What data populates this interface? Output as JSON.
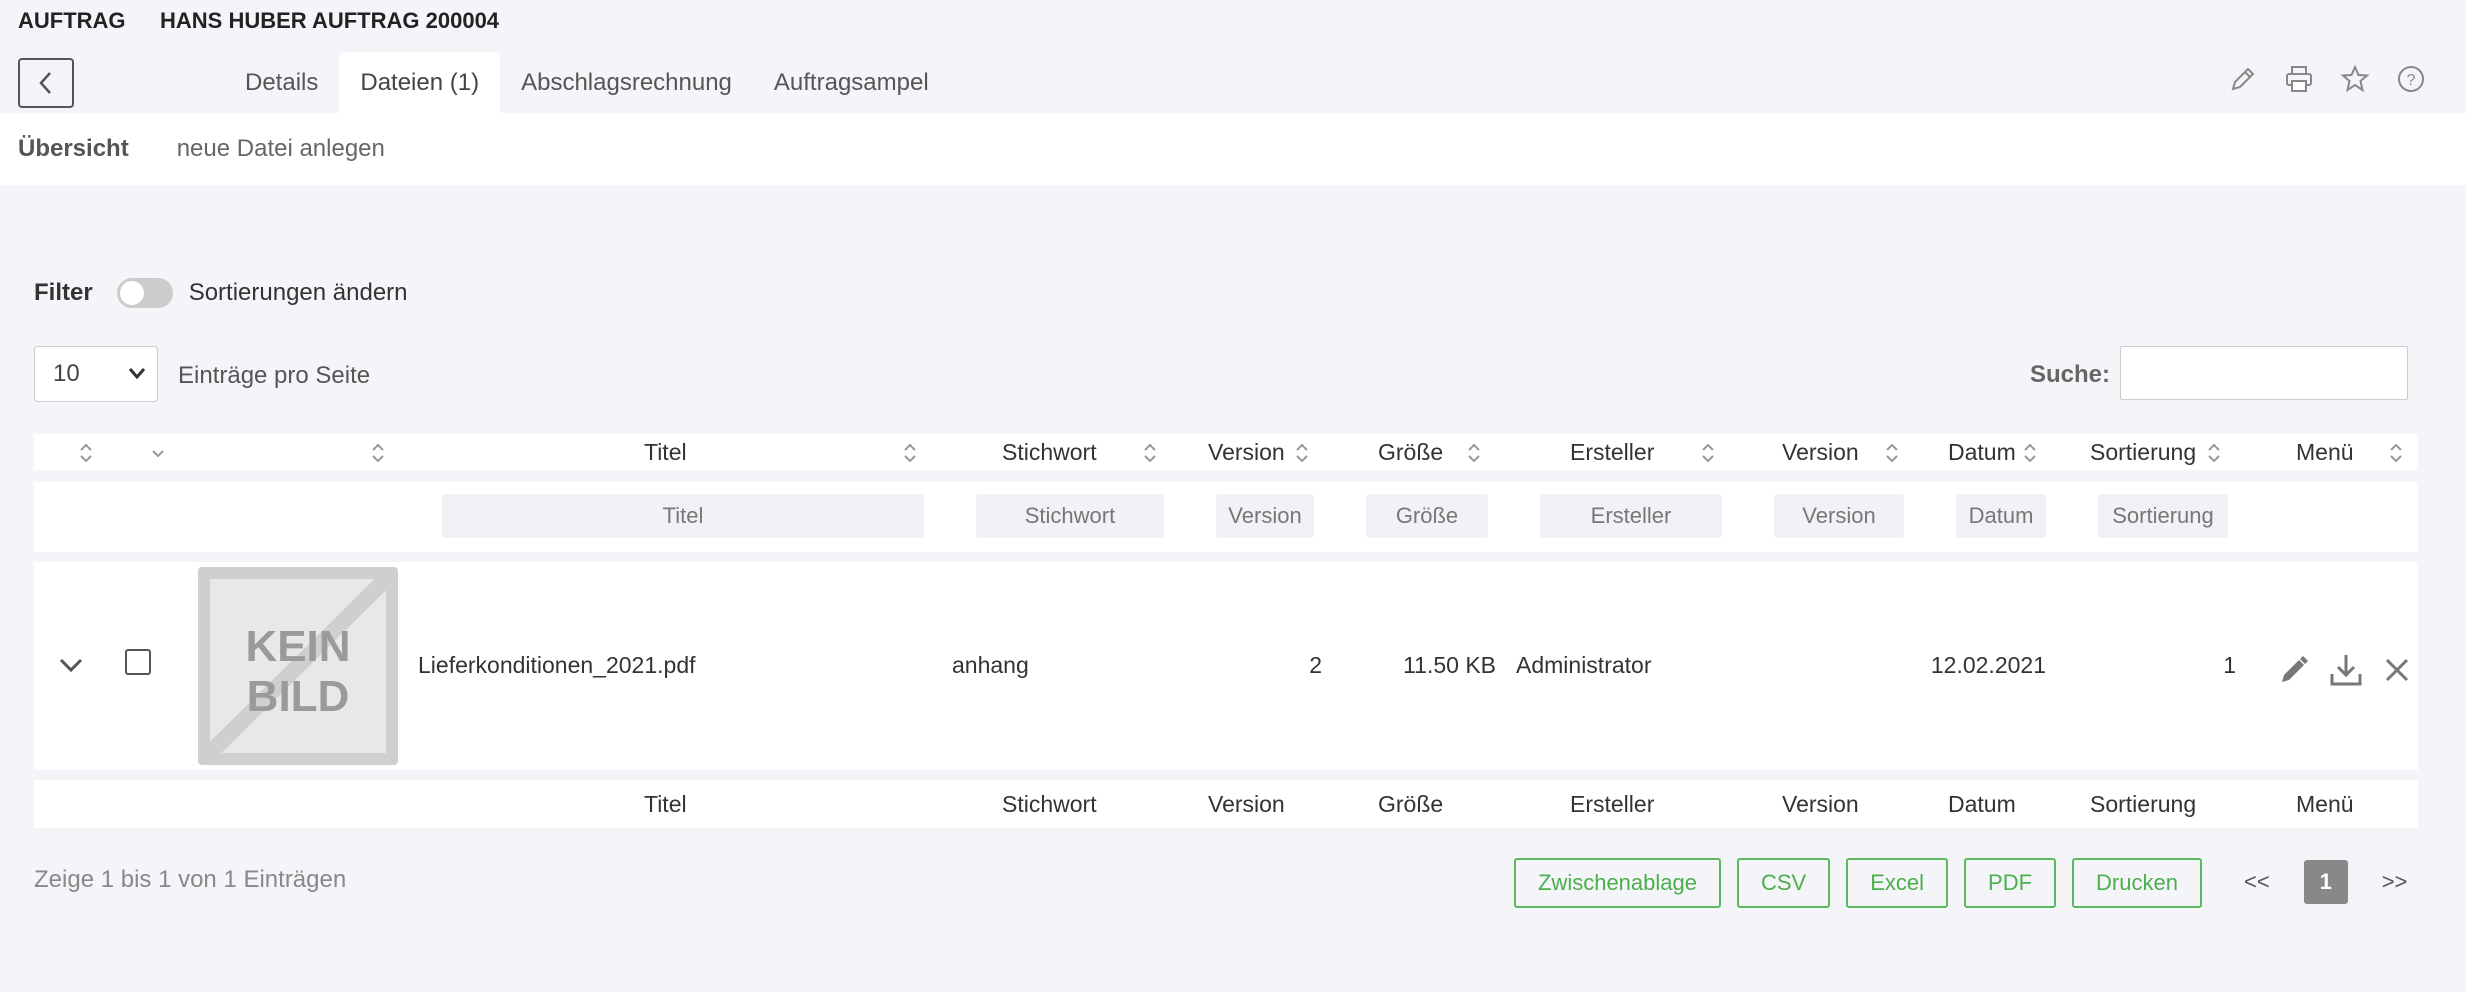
{
  "header": {
    "label": "AUFTRAG",
    "title": "HANS HUBER AUFTRAG 200004",
    "tabs": [
      "Details",
      "Dateien (1)",
      "Abschlagsrechnung",
      "Auftragsampel"
    ],
    "active_tab": 1
  },
  "subnav": {
    "items": [
      "Übersicht",
      "neue Datei anlegen"
    ]
  },
  "filter": {
    "label": "Filter",
    "toggle_label": "Sortierungen ändern",
    "toggle_on": false
  },
  "length": {
    "value": "10",
    "label": "Einträge pro Seite"
  },
  "search": {
    "label": "Suche:",
    "value": ""
  },
  "table": {
    "columns": [
      "Titel",
      "Stichwort",
      "Version",
      "Größe",
      "Ersteller",
      "Version",
      "Datum",
      "Sortierung",
      "Menü"
    ],
    "filter_placeholders": [
      "Titel",
      "Stichwort",
      "Version",
      "Größe",
      "Ersteller",
      "Version",
      "Datum",
      "Sortierung"
    ],
    "rows": [
      {
        "thumb_line1": "KEIN",
        "thumb_line2": "BILD",
        "titel": "Lieferkonditionen_2021.pdf",
        "stichwort": "anhang",
        "version": "2",
        "groesse": "11.50 KB",
        "ersteller": "Administrator",
        "version2": "",
        "datum": "12.02.2021",
        "sortierung": "1"
      }
    ]
  },
  "info": "Zeige 1 bis 1 von 1 Einträgen",
  "export_buttons": [
    "Zwischenablage",
    "CSV",
    "Excel",
    "PDF",
    "Drucken"
  ],
  "pager": {
    "prev": "<<",
    "current": "1",
    "next": ">>"
  },
  "colors": {
    "background": "#f4f5f9",
    "accent_green": "#5cb85c",
    "pager_active": "#888888"
  }
}
